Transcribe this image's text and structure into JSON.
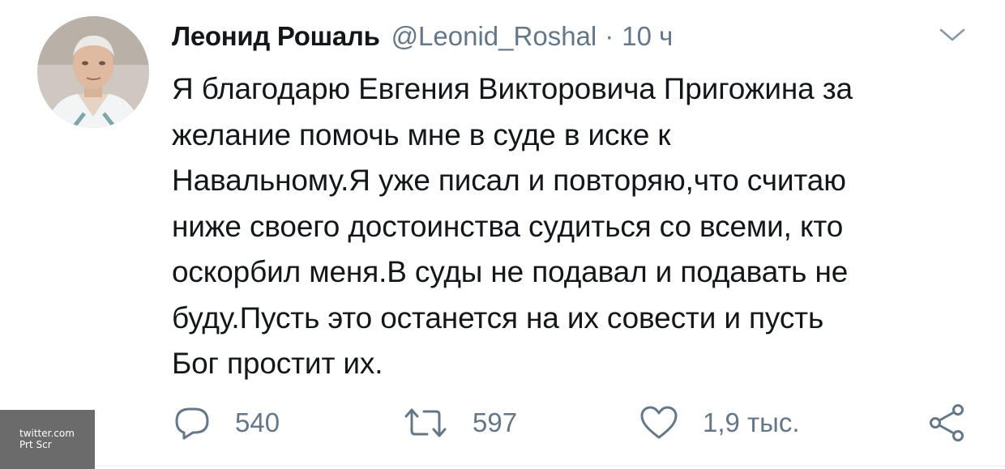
{
  "tweet": {
    "author_name": "Леонид Рошаль",
    "author_handle": "@Leonid_Roshal",
    "separator": "·",
    "timestamp": "10 ч",
    "text_lines": [
      "Я благодарю Евгения Викторовича Пригожина за",
      "желание помочь мне в суде в иске к",
      "Навальному.Я уже писал и повторяю,что считаю",
      "ниже своего достоинства судиться со всеми, кто",
      "оскорбил меня.В суды не подавал и подавать не",
      "буду.Пусть это останется на их совести и пусть",
      "Бог простит их."
    ]
  },
  "actions": {
    "reply": {
      "icon": "reply-icon",
      "count": "540"
    },
    "retweet": {
      "icon": "retweet-icon",
      "count": "597"
    },
    "like": {
      "icon": "heart-icon",
      "count": "1,9 тыс."
    },
    "share": {
      "icon": "share-icon"
    }
  },
  "watermark": {
    "line1": "twitter.com",
    "line2": "Prt Scr"
  },
  "colors": {
    "text": "#14171a",
    "secondary": "#657786",
    "divider": "#e6ecf0",
    "watermark_bg": "#6b6b6b"
  }
}
